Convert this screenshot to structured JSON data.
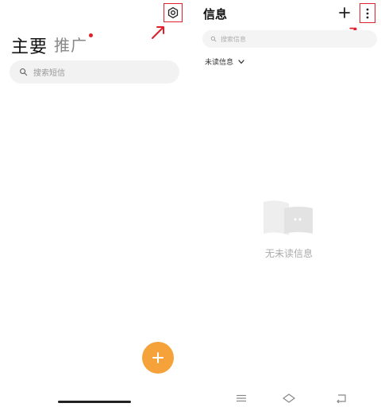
{
  "left_screen": {
    "tabs": [
      {
        "label": "主要",
        "selected": true
      },
      {
        "label": "推广",
        "selected": false,
        "has_badge": true
      }
    ],
    "search": {
      "placeholder": "搜索短信"
    },
    "settings_icon": "gear-icon",
    "fab_icon": "plus-icon",
    "highlight_color": "#e0202a",
    "fab_color": "#f6a23a"
  },
  "right_screen": {
    "title": "信息",
    "add_icon": "plus-icon",
    "more_icon": "more-vertical-icon",
    "search": {
      "placeholder": "搜索信息"
    },
    "filter": {
      "label": "未读信息"
    },
    "empty_state": {
      "text": "无未读信息"
    },
    "nav_icons": [
      "menu-icon",
      "home-icon",
      "back-icon"
    ]
  }
}
